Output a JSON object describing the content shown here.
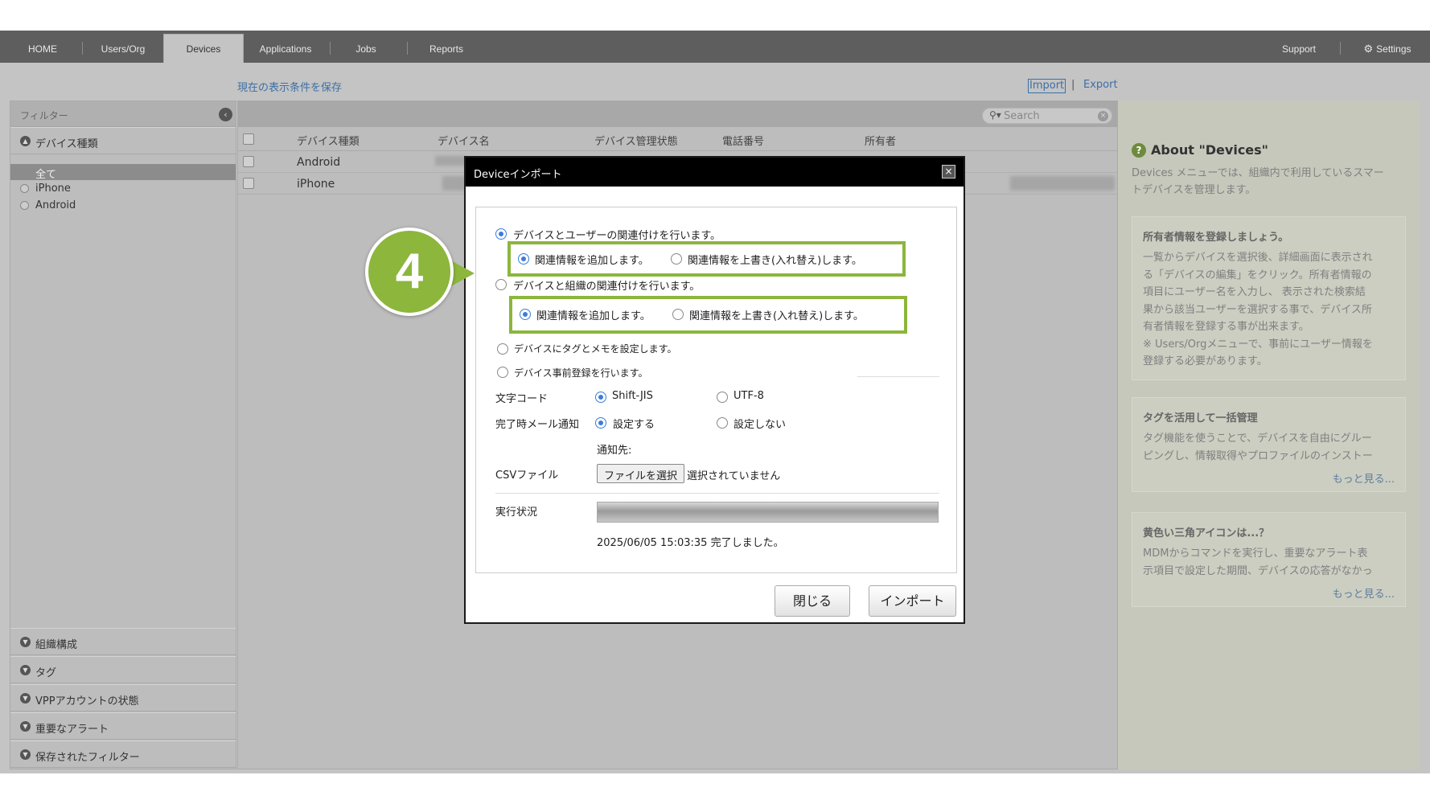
{
  "nav": {
    "items": [
      "HOME",
      "Users/Org",
      "Devices",
      "Applications",
      "Jobs",
      "Reports"
    ],
    "support": "Support",
    "settings": "Settings"
  },
  "toolbar": {
    "save_filter": "現在の表示条件を保存",
    "import": "Import",
    "sep": "|",
    "export": "Export"
  },
  "sidebar": {
    "title": "フィルター",
    "device_type": "デバイス種類",
    "options": [
      "全て",
      "iPhone",
      "Android"
    ],
    "sections": [
      "組織構成",
      "タグ",
      "VPPアカウントの状態",
      "重要なアラート",
      "保存されたフィルター"
    ]
  },
  "search": {
    "placeholder": "Search"
  },
  "table": {
    "headers": [
      "デバイス種類",
      "デバイス名",
      "デバイス管理状態",
      "電話番号",
      "所有者"
    ],
    "rows": [
      {
        "device_type": "Android"
      },
      {
        "device_type": "iPhone"
      }
    ]
  },
  "right_panel": {
    "title": "About \"Devices\"",
    "intro": [
      "Devices メニューでは、組織内で利用しているスマー",
      "トデバイスを管理します。"
    ],
    "cards": [
      {
        "title": "所有者情報を登録しましょう。",
        "lines": [
          "一覧からデバイスを選択後、詳細画面に表示され",
          "る「デバイスの編集」をクリック。所有者情報の",
          "項目にユーザー名を入力し、 表示された検索結",
          "果から該当ユーザーを選択する事で、デバイス所",
          "有者情報を登録する事が出来ます。",
          "※ Users/Orgメニューで、事前にユーザー情報を",
          "登録する必要があります。"
        ]
      },
      {
        "title": "タグを活用して一括管理",
        "lines": [
          "タグ機能を使うことで、デバイスを自由にグルー",
          "ピングし、情報取得やプロファイルのインストー"
        ],
        "more": "もっと見る..."
      },
      {
        "title": "黄色い三角アイコンは...？",
        "lines": [
          "MDMからコマンドを実行し、重要なアラート表",
          "示項目で設定した期間、デバイスの応答がなかっ"
        ],
        "more": "もっと見る..."
      }
    ]
  },
  "dialog": {
    "title": "Deviceインポート",
    "opt_user": "デバイスとユーザーの関連付けを行います。",
    "opt_org": "デバイスと組織の関連付けを行います。",
    "sub_add": "関連情報を追加します。",
    "sub_overwrite": "関連情報を上書き(入れ替え)します。",
    "opt_tag": "デバイスにタグとメモを設定します。",
    "opt_prereg": "デバイス事前登録を行います。",
    "charcode_label": "文字コード",
    "charcode_sjis": "Shift-JIS",
    "charcode_utf8": "UTF-8",
    "mail_label": "完了時メール通知",
    "mail_on": "設定する",
    "mail_off": "設定しない",
    "notify_to": "通知先:",
    "csv_label": "CSVファイル",
    "file_button": "ファイルを選択",
    "file_status": "選択されていません",
    "status_label": "実行状況",
    "progress": 1.0,
    "status_text": "2025/06/05 15:03:35 完了しました。",
    "close_button": "閉じる",
    "import_button": "インポート"
  },
  "callout": {
    "number": "4",
    "color": "#8cb63c"
  }
}
